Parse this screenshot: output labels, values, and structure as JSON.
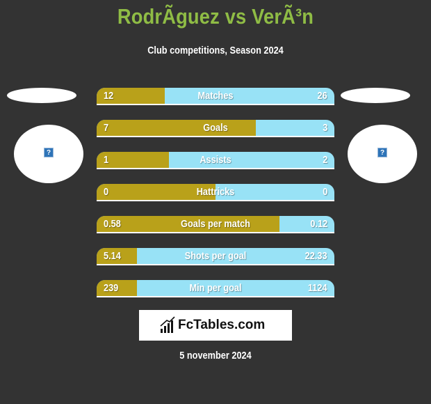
{
  "header": {
    "title": "RodrÃguez vs VerÃ³n",
    "subtitle": "Club competitions, Season 2024"
  },
  "players": {
    "left": {
      "avatar_icon": "broken-image-icon",
      "glyph": "?"
    },
    "right": {
      "avatar_icon": "broken-image-icon",
      "glyph": "?"
    }
  },
  "colors": {
    "background": "#333333",
    "title": "#8fbc45",
    "left_bar": "#b9a11a",
    "right_bar": "#98e2f6"
  },
  "stats": [
    {
      "label": "Matches",
      "left": "12",
      "right": "26",
      "left_share": 0.287
    },
    {
      "label": "Goals",
      "left": "7",
      "right": "3",
      "left_share": 0.67
    },
    {
      "label": "Assists",
      "left": "1",
      "right": "2",
      "left_share": 0.305
    },
    {
      "label": "Hattricks",
      "left": "0",
      "right": "0",
      "left_share": 0.5
    },
    {
      "label": "Goals per match",
      "left": "0.58",
      "right": "0.12",
      "left_share": 0.77
    },
    {
      "label": "Shots per goal",
      "left": "5.14",
      "right": "22.33",
      "left_share": 0.17
    },
    {
      "label": "Min per goal",
      "left": "239",
      "right": "1124",
      "left_share": 0.17
    }
  ],
  "logo": {
    "text": "FcTables.com",
    "icon": "bar-chart-icon"
  },
  "footer": {
    "date": "5 november 2024"
  }
}
